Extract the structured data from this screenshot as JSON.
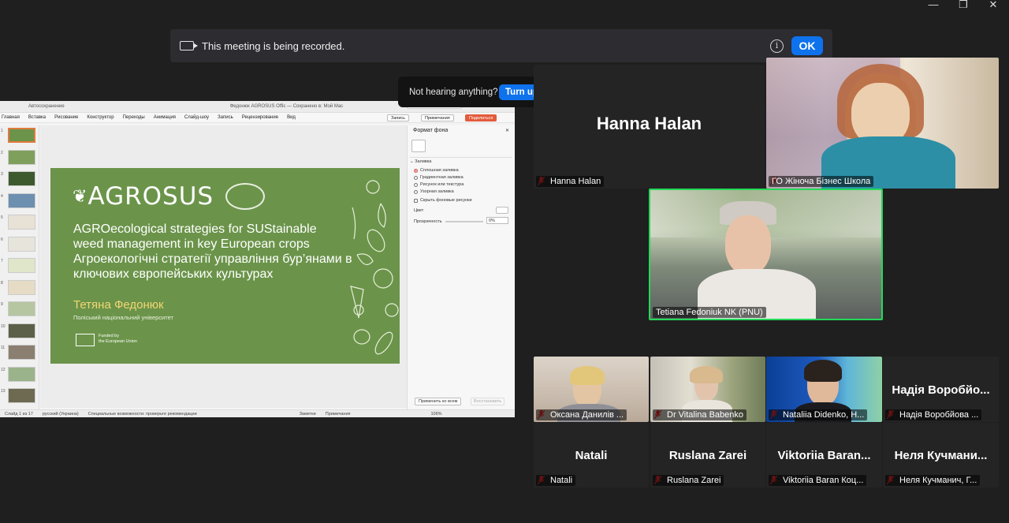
{
  "window_controls": {
    "minimize": "—",
    "restore": "❐",
    "close": "✕"
  },
  "recording_banner": {
    "message": "This meeting is being recorded.",
    "ok_label": "OK",
    "info": "i"
  },
  "volume_toast": {
    "message": "Not hearing anything?",
    "button": "Turn up volume",
    "close": "×"
  },
  "shared_screen": {
    "autosave": "Автосохранение",
    "doc_title": "Федонюк AGROSUS Offic — Сохранено в: Мой Мас",
    "tabs": [
      "Главная",
      "Вставка",
      "Рисование",
      "Конструктор",
      "Переходы",
      "Анимация",
      "Слайд-шоу",
      "Запись",
      "Рецензирование",
      "Вид"
    ],
    "record_btn": "Запись",
    "comments_btn": "Примечания",
    "share_btn": "Поделиться",
    "slide_numbers": [
      "1",
      "2",
      "3",
      "4",
      "5",
      "6",
      "7",
      "8",
      "9",
      "10",
      "11",
      "12",
      "13"
    ],
    "slide": {
      "logo": "AGROSUS",
      "en_title": "AGROecological strategies for SUStainable weed management in key European crops",
      "ua_title": "Агроекологічні стратегії управління бур’янами в ключових європейських культурах",
      "author": "Тетяна Федонюк",
      "university": "Поліський національний університет",
      "funded": "Funded by\nthe European Union"
    },
    "pane": {
      "title": "Формат фона",
      "section": "Заливка",
      "options": [
        "Сплошная заливка",
        "Градиентная заливка",
        "Рисунок или текстура",
        "Узорная заливка"
      ],
      "hide_bg": "Скрыть фоновые рисунки",
      "color_label": "Цвет",
      "transparency_label": "Прозрачность",
      "transparency_value": "0%",
      "apply_all": "Применить ко всем",
      "restore": "Восстановить"
    },
    "status": {
      "slide_info": "Слайд 1 из 17",
      "language": "русский (Украина)",
      "accessibility": "Специальные возможности: проверьте рекомендации",
      "notes": "Заметки",
      "comments": "Примечания",
      "zoom": "106%"
    }
  },
  "participants": {
    "hanna": {
      "big": "Hanna Halan",
      "tag": "Hanna Halan"
    },
    "zhinocha": {
      "tag": "ГО Жіноча Бізнес Школа"
    },
    "tetiana": {
      "tag": "Tetiana Fedoniuk NK (PNU)"
    },
    "row1": [
      {
        "tag": "Оксана Данилів ..."
      },
      {
        "tag": "Dr Vitalina Babenko"
      },
      {
        "tag": "Nataliia Didenko, H..."
      },
      {
        "big": "Надія Воробйо...",
        "tag": "Надія Воробйова ..."
      }
    ],
    "row2": [
      {
        "big": "Natali",
        "tag": "Natali"
      },
      {
        "big": "Ruslana Zarei",
        "tag": "Ruslana Zarei"
      },
      {
        "big": "Viktoriia Baran...",
        "tag": "Viktoriia Baran Коц..."
      },
      {
        "big": "Неля Кучмани...",
        "tag": "Неля Кучманич, Г..."
      }
    ]
  },
  "colors": {
    "speaker_border": "#23d959",
    "accent_blue": "#0e72ed",
    "slide_green": "#6b944a",
    "mic_muted": "#e02828"
  }
}
